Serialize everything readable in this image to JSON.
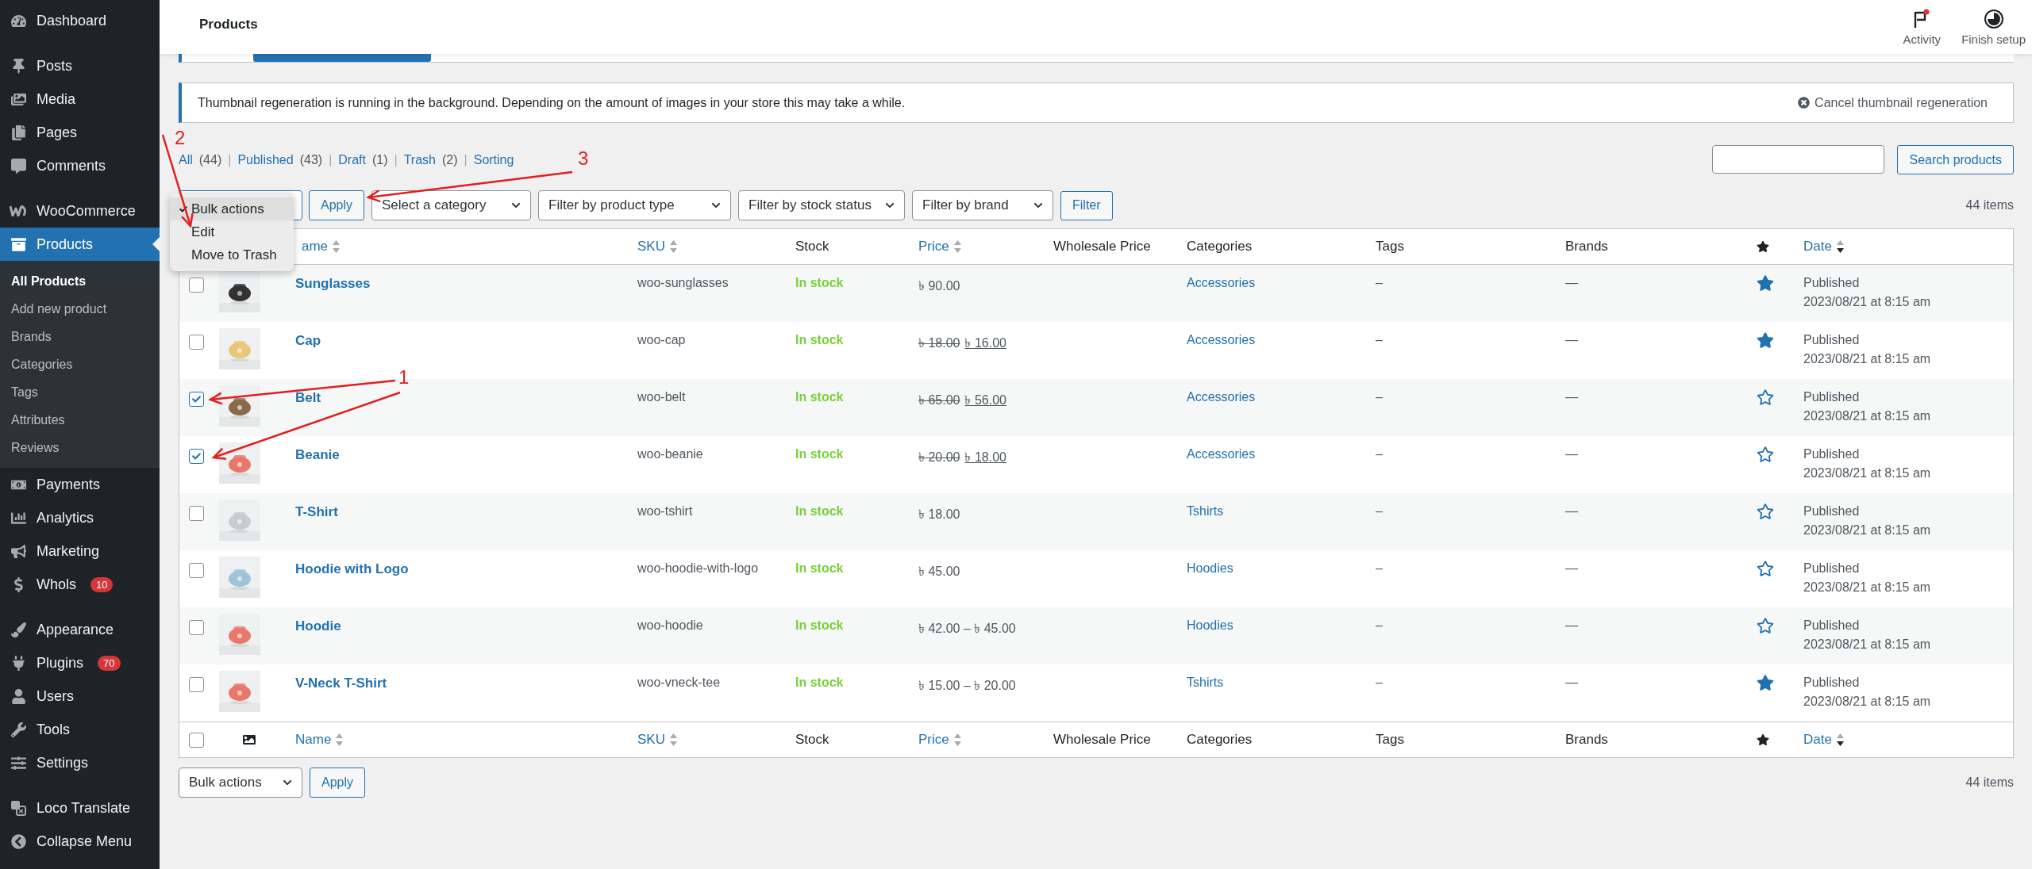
{
  "sidebar": {
    "groups": [
      [
        {
          "label": "Dashboard",
          "selected": false
        }
      ],
      [
        {
          "label": "Posts",
          "selected": false
        },
        {
          "label": "Media",
          "selected": false
        },
        {
          "label": "Pages",
          "selected": false
        },
        {
          "label": "Comments",
          "selected": false
        }
      ],
      [
        {
          "label": "WooCommerce",
          "selected": false
        },
        {
          "label": "Products",
          "selected": true,
          "submenu": [
            {
              "label": "All Products",
              "selected": true
            },
            {
              "label": "Add new product",
              "selected": false
            },
            {
              "label": "Brands",
              "selected": false
            },
            {
              "label": "Categories",
              "selected": false
            },
            {
              "label": "Tags",
              "selected": false
            },
            {
              "label": "Attributes",
              "selected": false
            },
            {
              "label": "Reviews",
              "selected": false
            }
          ]
        },
        {
          "label": "Payments",
          "selected": false
        },
        {
          "label": "Analytics",
          "selected": false
        },
        {
          "label": "Marketing",
          "selected": false
        },
        {
          "label": "Whols",
          "selected": false,
          "badge": "10"
        }
      ],
      [
        {
          "label": "Appearance",
          "selected": false
        },
        {
          "label": "Plugins",
          "selected": false,
          "badge": "70"
        },
        {
          "label": "Users",
          "selected": false
        },
        {
          "label": "Tools",
          "selected": false
        },
        {
          "label": "Settings",
          "selected": false
        }
      ],
      [
        {
          "label": "Loco Translate",
          "selected": false
        },
        {
          "label": "Collapse Menu",
          "selected": false
        }
      ]
    ]
  },
  "header": {
    "title": "Products",
    "actions": [
      {
        "label": "Activity"
      },
      {
        "label": "Finish setup"
      }
    ]
  },
  "notice": {
    "text": "Thumbnail regeneration is running in the background. Depending on the amount of images in your store this may take a while.",
    "action": "Cancel thumbnail regeneration"
  },
  "views": [
    {
      "label": "All",
      "count": "(44)"
    },
    {
      "separator": "|",
      "label": "Published",
      "count": "(43)"
    },
    {
      "separator": "|",
      "label": "Draft",
      "count": "(1)"
    },
    {
      "separator": "|",
      "label": "Trash",
      "count": "(2)"
    },
    {
      "separator": "|",
      "label": "Sorting"
    }
  ],
  "search": {
    "button": "Search products"
  },
  "bulk_menu": {
    "options": [
      {
        "label": "Bulk actions",
        "selected": true
      },
      {
        "label": "Edit",
        "selected": false
      },
      {
        "label": "Move to Trash",
        "selected": false
      }
    ]
  },
  "apply": "Apply",
  "filters": [
    {
      "label": "Select a category"
    },
    {
      "label": "Filter by product type"
    },
    {
      "label": "Filter by stock status"
    },
    {
      "label": "Filter by brand"
    }
  ],
  "filter_button": "Filter",
  "count": "44 items",
  "table": {
    "header": [
      {
        "label": "ame",
        "kind": "sortable"
      },
      {
        "label": "SKU",
        "kind": "sortable"
      },
      {
        "label": "Stock",
        "kind": "plain"
      },
      {
        "label": "Price",
        "kind": "sortable"
      },
      {
        "label": "Wholesale Price",
        "kind": "plain"
      },
      {
        "label": "Categories",
        "kind": "plain"
      },
      {
        "label": "Tags",
        "kind": "plain"
      },
      {
        "label": "Brands",
        "kind": "plain"
      },
      {
        "kind": "featured"
      },
      {
        "label": "Date",
        "kind": "sorted"
      }
    ],
    "rows": [
      {
        "checked": false,
        "name": "Sunglasses",
        "sku": "woo-sunglasses",
        "stock": "In stock",
        "price": "৳ 90.00",
        "categories": "Accessories",
        "tags": "–",
        "brands": "—",
        "featured": true,
        "status": "Published",
        "date": "2023/08/21 at 8:15 am"
      },
      {
        "checked": false,
        "name": "Cap",
        "sku": "woo-cap",
        "stock": "In stock",
        "price_old": "৳ 18.00",
        "price": "৳ 16.00",
        "categories": "Accessories",
        "tags": "–",
        "brands": "—",
        "featured": true,
        "status": "Published",
        "date": "2023/08/21 at 8:15 am"
      },
      {
        "checked": true,
        "name": "Belt",
        "sku": "woo-belt",
        "stock": "In stock",
        "price_old": "৳ 65.00",
        "price": "৳ 56.00",
        "categories": "Accessories",
        "tags": "–",
        "brands": "—",
        "featured": false,
        "status": "Published",
        "date": "2023/08/21 at 8:15 am"
      },
      {
        "checked": true,
        "name": "Beanie",
        "sku": "woo-beanie",
        "stock": "In stock",
        "price_old": "৳ 20.00",
        "price": "৳ 18.00",
        "categories": "Accessories",
        "tags": "–",
        "brands": "—",
        "featured": false,
        "status": "Published",
        "date": "2023/08/21 at 8:15 am"
      },
      {
        "checked": false,
        "name": "T-Shirt",
        "sku": "woo-tshirt",
        "stock": "In stock",
        "price": "৳ 18.00",
        "categories": "Tshirts",
        "tags": "–",
        "brands": "—",
        "featured": false,
        "status": "Published",
        "date": "2023/08/21 at 8:15 am"
      },
      {
        "checked": false,
        "name": "Hoodie with Logo",
        "sku": "woo-hoodie-with-logo",
        "stock": "In stock",
        "price": "৳ 45.00",
        "categories": "Hoodies",
        "tags": "–",
        "brands": "—",
        "featured": false,
        "status": "Published",
        "date": "2023/08/21 at 8:15 am"
      },
      {
        "checked": false,
        "name": "Hoodie",
        "sku": "woo-hoodie",
        "stock": "In stock",
        "price": "৳ 42.00 – ৳ 45.00",
        "categories": "Hoodies",
        "tags": "–",
        "brands": "—",
        "featured": false,
        "status": "Published",
        "date": "2023/08/21 at 8:15 am"
      },
      {
        "checked": false,
        "name": "V-Neck T-Shirt",
        "sku": "woo-vneck-tee",
        "stock": "In stock",
        "price": "৳ 15.00 – ৳ 20.00",
        "categories": "Tshirts",
        "tags": "–",
        "brands": "—",
        "featured": true,
        "status": "Published",
        "date": "2023/08/21 at 8:15 am"
      }
    ],
    "footer_checkbox": {
      "checked": false
    },
    "footer": [
      {
        "label": "Name",
        "kind": "sortable"
      },
      {
        "label": "SKU",
        "kind": "sortable"
      },
      {
        "label": "Stock",
        "kind": "plain"
      },
      {
        "label": "Price",
        "kind": "sortable"
      },
      {
        "label": "Wholesale Price",
        "kind": "plain"
      },
      {
        "label": "Categories",
        "kind": "plain"
      },
      {
        "label": "Tags",
        "kind": "plain"
      },
      {
        "label": "Brands",
        "kind": "plain"
      },
      {
        "kind": "featured"
      },
      {
        "label": "Date",
        "kind": "sorted"
      }
    ]
  },
  "bottom": {
    "bulk": "Bulk actions",
    "apply": "Apply",
    "count": "44 items"
  },
  "annotations": [
    {
      "label": "1"
    },
    {
      "label": "2"
    },
    {
      "label": "3"
    }
  ]
}
